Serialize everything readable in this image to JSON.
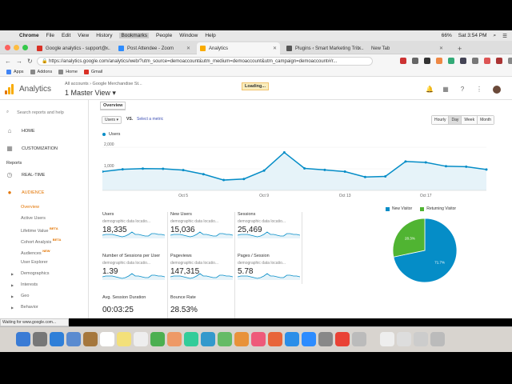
{
  "menubar": {
    "apple": "",
    "app": "Chrome",
    "menus": [
      "File",
      "Edit",
      "View",
      "History",
      "Bookmarks",
      "People",
      "Window",
      "Help"
    ],
    "battery": "66%",
    "clock": "Sat 3:54 PM"
  },
  "tabs": [
    {
      "title": "Google analytics - support@...",
      "color": "#d93025"
    },
    {
      "title": "Post Attendee - Zoom",
      "color": "#2d8cff"
    },
    {
      "title": "Analytics",
      "color": "#f9ab00"
    },
    {
      "title": "Plugins ‹ Smart Marketing Trib...",
      "color": "#555555"
    },
    {
      "title": "New Tab",
      "color": "#f6f6f6"
    }
  ],
  "address": {
    "url": "https://analytics.google.com/analytics/web/?utm_source=demoaccount&utm_medium=demoaccount&utm_campaign=demoaccount#/r..."
  },
  "bookmarks": [
    "Apps",
    "Addons",
    "Home",
    "Gmail"
  ],
  "ga": {
    "title": "Analytics",
    "breadcrumb": "All accounts › Google Merchandise St...",
    "account": "1 Master View ▾",
    "loading": "Loading..."
  },
  "sidebar": {
    "search": "Search reports and help",
    "home": "HOME",
    "customization": "CUSTOMIZATION",
    "reports": "Reports",
    "realtime": "REAL-TIME",
    "audience": "AUDIENCE",
    "sub": [
      {
        "label": "Overview",
        "badge": ""
      },
      {
        "label": "Active Users",
        "badge": ""
      },
      {
        "label": "Lifetime Value",
        "badge": "BETA"
      },
      {
        "label": "Cohort Analysis",
        "badge": "BETA"
      },
      {
        "label": "Audiences",
        "badge": "NEW"
      },
      {
        "label": "User Explorer",
        "badge": ""
      },
      {
        "label": "Demographics",
        "badge": ""
      },
      {
        "label": "Interests",
        "badge": ""
      },
      {
        "label": "Geo",
        "badge": ""
      },
      {
        "label": "Behavior",
        "badge": ""
      }
    ]
  },
  "main": {
    "overview_tab": "Overview",
    "metric": "Users ▾",
    "vs": "VS.",
    "select_metric": "Select a metric",
    "granularity": [
      "Hourly",
      "Day",
      "Week",
      "Month"
    ],
    "legend": "Users"
  },
  "scorecards": [
    {
      "label": "Users",
      "sub": "demographic data locatio...",
      "value": "18,335"
    },
    {
      "label": "New Users",
      "sub": "demographic data locatio...",
      "value": "15,036"
    },
    {
      "label": "Sessions",
      "sub": "demographic data locatio...",
      "value": "25,469"
    },
    {
      "label": "Number of Sessions per User",
      "sub": "demographic data locatio...",
      "value": "1.39"
    },
    {
      "label": "Pageviews",
      "sub": "demographic data locatio...",
      "value": "147,315"
    },
    {
      "label": "Pages / Session",
      "sub": "demographic data locatio...",
      "value": "5.78"
    },
    {
      "label": "Avg. Session Duration",
      "sub": "",
      "value": "00:03:25"
    },
    {
      "label": "Bounce Rate",
      "sub": "",
      "value": "28.53%"
    }
  ],
  "pie": {
    "legend": [
      "New Visitor",
      "Returning Visitor"
    ],
    "labels": [
      "71.7%",
      "28.3%"
    ],
    "colors": [
      "#058dc7",
      "#50b432"
    ]
  },
  "status": "Waiting for www.google.com...",
  "chart_data": [
    {
      "type": "line",
      "series": [
        {
          "name": "Users",
          "values": [
            870,
            980,
            1010,
            1000,
            940,
            750,
            480,
            530,
            920,
            1760,
            1020,
            950,
            870,
            620,
            650,
            1340,
            1300,
            1120,
            1100,
            970
          ]
        }
      ],
      "x_ticks": [
        "Oct 5",
        "Oct 9",
        "Oct 13",
        "Oct 17"
      ],
      "y_ticks": [
        "1,000",
        "2,000"
      ],
      "ylim": [
        0,
        2300
      ]
    },
    {
      "type": "pie",
      "categories": [
        "New Visitor",
        "Returning Visitor"
      ],
      "values": [
        71.7,
        28.3
      ]
    }
  ]
}
